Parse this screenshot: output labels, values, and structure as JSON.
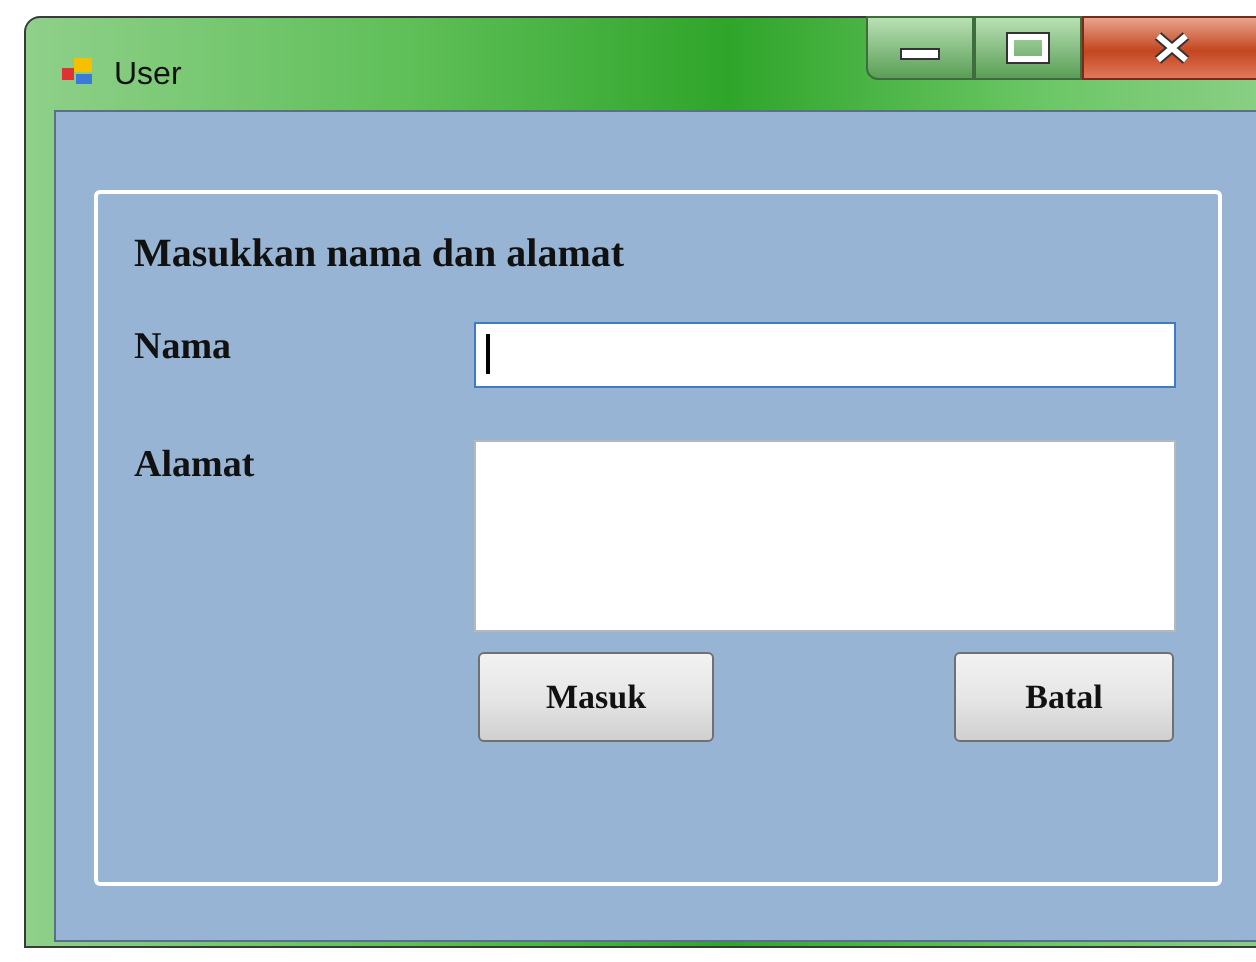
{
  "window": {
    "title": "User"
  },
  "panel": {
    "heading": "Masukkan nama dan alamat",
    "fields": [
      {
        "label": "Nama",
        "kind": "line",
        "focused": true
      },
      {
        "label": "Alamat",
        "kind": "multiline",
        "focused": false
      }
    ],
    "buttons": [
      "Masuk",
      "Batal"
    ]
  }
}
